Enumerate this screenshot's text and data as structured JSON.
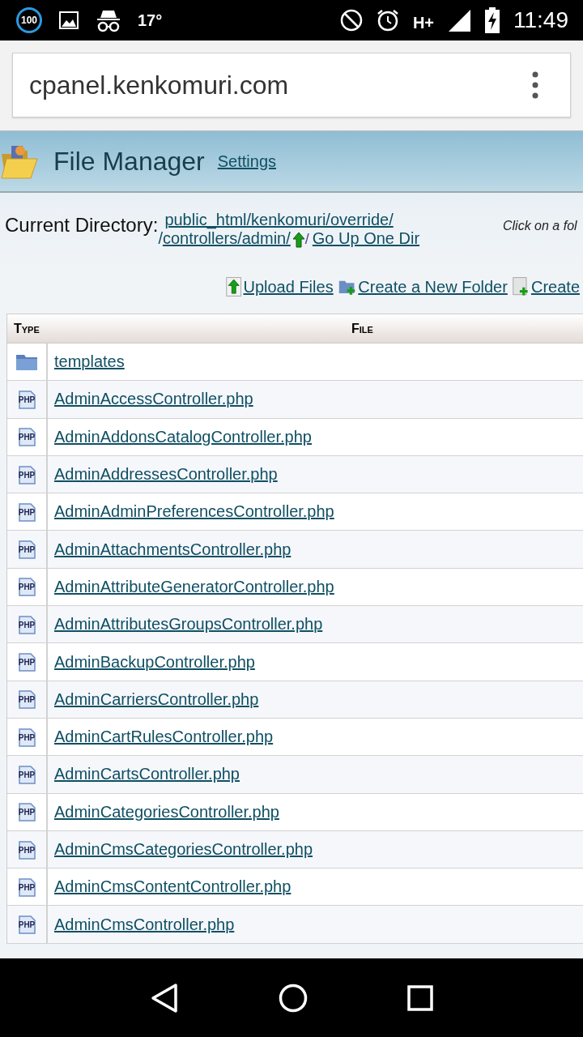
{
  "status_bar": {
    "battery_badge": "100",
    "temperature": "17°",
    "network": "H+",
    "time": "11:49"
  },
  "browser": {
    "url": "cpanel.kenkomuri.com"
  },
  "header": {
    "title": "File Manager",
    "settings_link": "Settings"
  },
  "directory": {
    "label": "Current Directory:",
    "path_line_1": "public_html/kenkomuri/override/",
    "path_line_2_prefix": "/",
    "path_line_2": "controllers/admin/",
    "separator": "/",
    "go_up": "Go Up One Dir",
    "hint": "Click on a fol"
  },
  "actions": [
    {
      "kind": "upload",
      "label": "Upload Files"
    },
    {
      "kind": "folder",
      "label": "Create a New Folder"
    },
    {
      "kind": "file",
      "label": "Create"
    }
  ],
  "table": {
    "columns": [
      "Type",
      "File"
    ],
    "rows": [
      {
        "kind": "folder",
        "name": "templates"
      },
      {
        "kind": "php",
        "icon_text": "PHP",
        "name": "AdminAccessController.php"
      },
      {
        "kind": "php",
        "icon_text": "PHP",
        "name": "AdminAddonsCatalogController.php"
      },
      {
        "kind": "php",
        "icon_text": "PHP",
        "name": "AdminAddressesController.php"
      },
      {
        "kind": "php",
        "icon_text": "PHP",
        "name": "AdminAdminPreferencesController.php"
      },
      {
        "kind": "php",
        "icon_text": "PHP",
        "name": "AdminAttachmentsController.php"
      },
      {
        "kind": "php",
        "icon_text": "PHP",
        "name": "AdminAttributeGeneratorController.php"
      },
      {
        "kind": "php",
        "icon_text": "PHP",
        "name": "AdminAttributesGroupsController.php"
      },
      {
        "kind": "php",
        "icon_text": "PHP",
        "name": "AdminBackupController.php"
      },
      {
        "kind": "php",
        "icon_text": "PHP",
        "name": "AdminCarriersController.php"
      },
      {
        "kind": "php",
        "icon_text": "PHP",
        "name": "AdminCartRulesController.php"
      },
      {
        "kind": "php",
        "icon_text": "PHP",
        "name": "AdminCartsController.php"
      },
      {
        "kind": "php",
        "icon_text": "PHP",
        "name": "AdminCategoriesController.php"
      },
      {
        "kind": "php",
        "icon_text": "PHP",
        "name": "AdminCmsCategoriesController.php"
      },
      {
        "kind": "php",
        "icon_text": "PHP",
        "name": "AdminCmsContentController.php"
      },
      {
        "kind": "php",
        "icon_text": "PHP",
        "name": "AdminCmsController.php"
      }
    ]
  }
}
